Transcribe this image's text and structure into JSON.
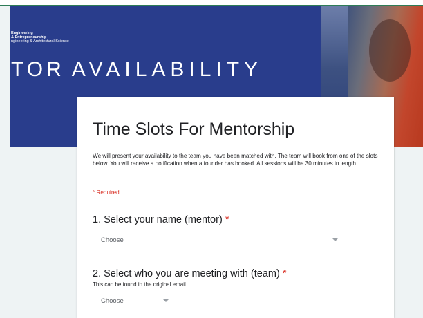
{
  "banner": {
    "logo_line1": "Engineering",
    "logo_line2": "& Entrepreneurship",
    "logo_line3": "ngineering & Architectural Science",
    "title_left": "TOR",
    "title_right": "AVAILABILITY",
    "accent_color": "#293d8c"
  },
  "form": {
    "title": "Time Slots For Mentorship",
    "description": "We will present your availability to the team you have been matched with. The team will book from one of the slots below. You will receive a notification when a founder has booked. All sessions will be 30 minutes in length.",
    "required_note": "* Required",
    "required_color": "#d93025",
    "questions": [
      {
        "title": "1. Select your name (mentor)",
        "asterisk": "*",
        "dropdown_value": "Choose",
        "icon": "caret-down-icon"
      },
      {
        "title": "2. Select who you are meeting with (team)",
        "asterisk": "*",
        "hint": "This can be found in the original email",
        "dropdown_value": "Choose",
        "icon": "caret-down-icon"
      }
    ]
  }
}
